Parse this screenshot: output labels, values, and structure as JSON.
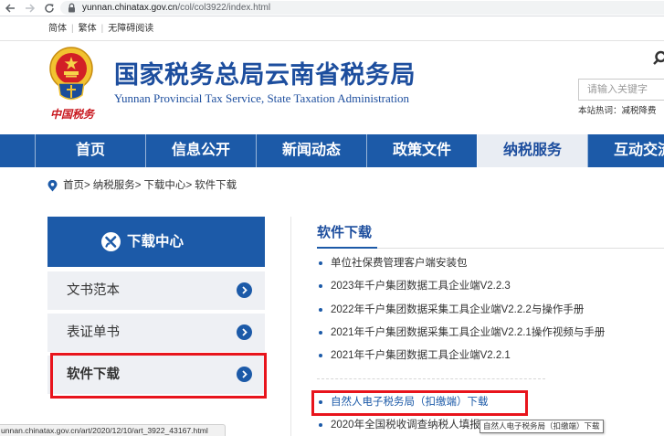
{
  "browser": {
    "url_host": "yunnan.chinatax.gov.cn",
    "url_path": "/col/col3922/index.html",
    "status_url": "unnan.chinatax.gov.cn/art/2020/12/10/art_3922_43167.html"
  },
  "topbar": {
    "links": [
      "简体",
      "繁体",
      "无障碍阅读"
    ],
    "separator": "|"
  },
  "header": {
    "emblem_text": "中国税务",
    "title": "国家税务总局云南省税务局",
    "subtitle": "Yunnan Provincial Tax Service, State Taxation Administration",
    "search_placeholder": "请输入关键字",
    "hot_label": "本站热词：",
    "hot_word": "减税降费"
  },
  "nav": {
    "items": [
      {
        "label": "首页",
        "active": false
      },
      {
        "label": "信息公开",
        "active": false
      },
      {
        "label": "新闻动态",
        "active": false
      },
      {
        "label": "政策文件",
        "active": false
      },
      {
        "label": "纳税服务",
        "active": true
      },
      {
        "label": "互动交流",
        "active": false
      }
    ]
  },
  "breadcrumb": {
    "items": [
      "首页",
      "纳税服务",
      "下载中心",
      "软件下载"
    ],
    "separator": ">"
  },
  "sidebar": {
    "title": "下载中心",
    "items": [
      {
        "label": "文书范本",
        "active": false
      },
      {
        "label": "表证单书",
        "active": false
      },
      {
        "label": "软件下载",
        "active": true
      }
    ]
  },
  "content": {
    "title": "软件下载",
    "items": [
      {
        "title": "单位社保费管理客户端安装包",
        "hovered": false
      },
      {
        "title": "2023年千户集团数据工具企业端V2.2.3",
        "hovered": false
      },
      {
        "title": "2022年千户集团数据采集工具企业端V2.2.2与操作手册",
        "hovered": false
      },
      {
        "title": "2021年千户集团数据采集工具企业端V2.2.1操作视频与手册",
        "hovered": false
      },
      {
        "title": "2021年千户集团数据工具企业端V2.2.1",
        "hovered": false
      },
      {
        "title": "自然人电子税务局（扣缴端）下载",
        "hovered": true
      },
      {
        "title": "2020年全国税收调查纳税人填报",
        "hovered": false
      }
    ]
  },
  "tooltip": {
    "text": "自然人电子税务局（扣缴端）下载"
  },
  "icons": {
    "back": "back-arrow-icon",
    "forward": "forward-arrow-icon",
    "reload": "reload-icon",
    "lock": "lock-icon",
    "emblem": "tax-emblem-icon",
    "search": "search-icon",
    "location": "location-pin-icon",
    "sidebar_header": "download-center-icon",
    "item_arrow": "chevron-right-circle-icon",
    "bullet": "bullet-dot-icon"
  },
  "colors": {
    "primary_blue": "#1c5aa8",
    "title_blue": "#1d4e9e",
    "active_tab_bg": "#e9edf3",
    "sidebar_item_bg": "#eef0f4",
    "annotation_red": "#e8141c",
    "emblem_red": "#c8161d"
  }
}
